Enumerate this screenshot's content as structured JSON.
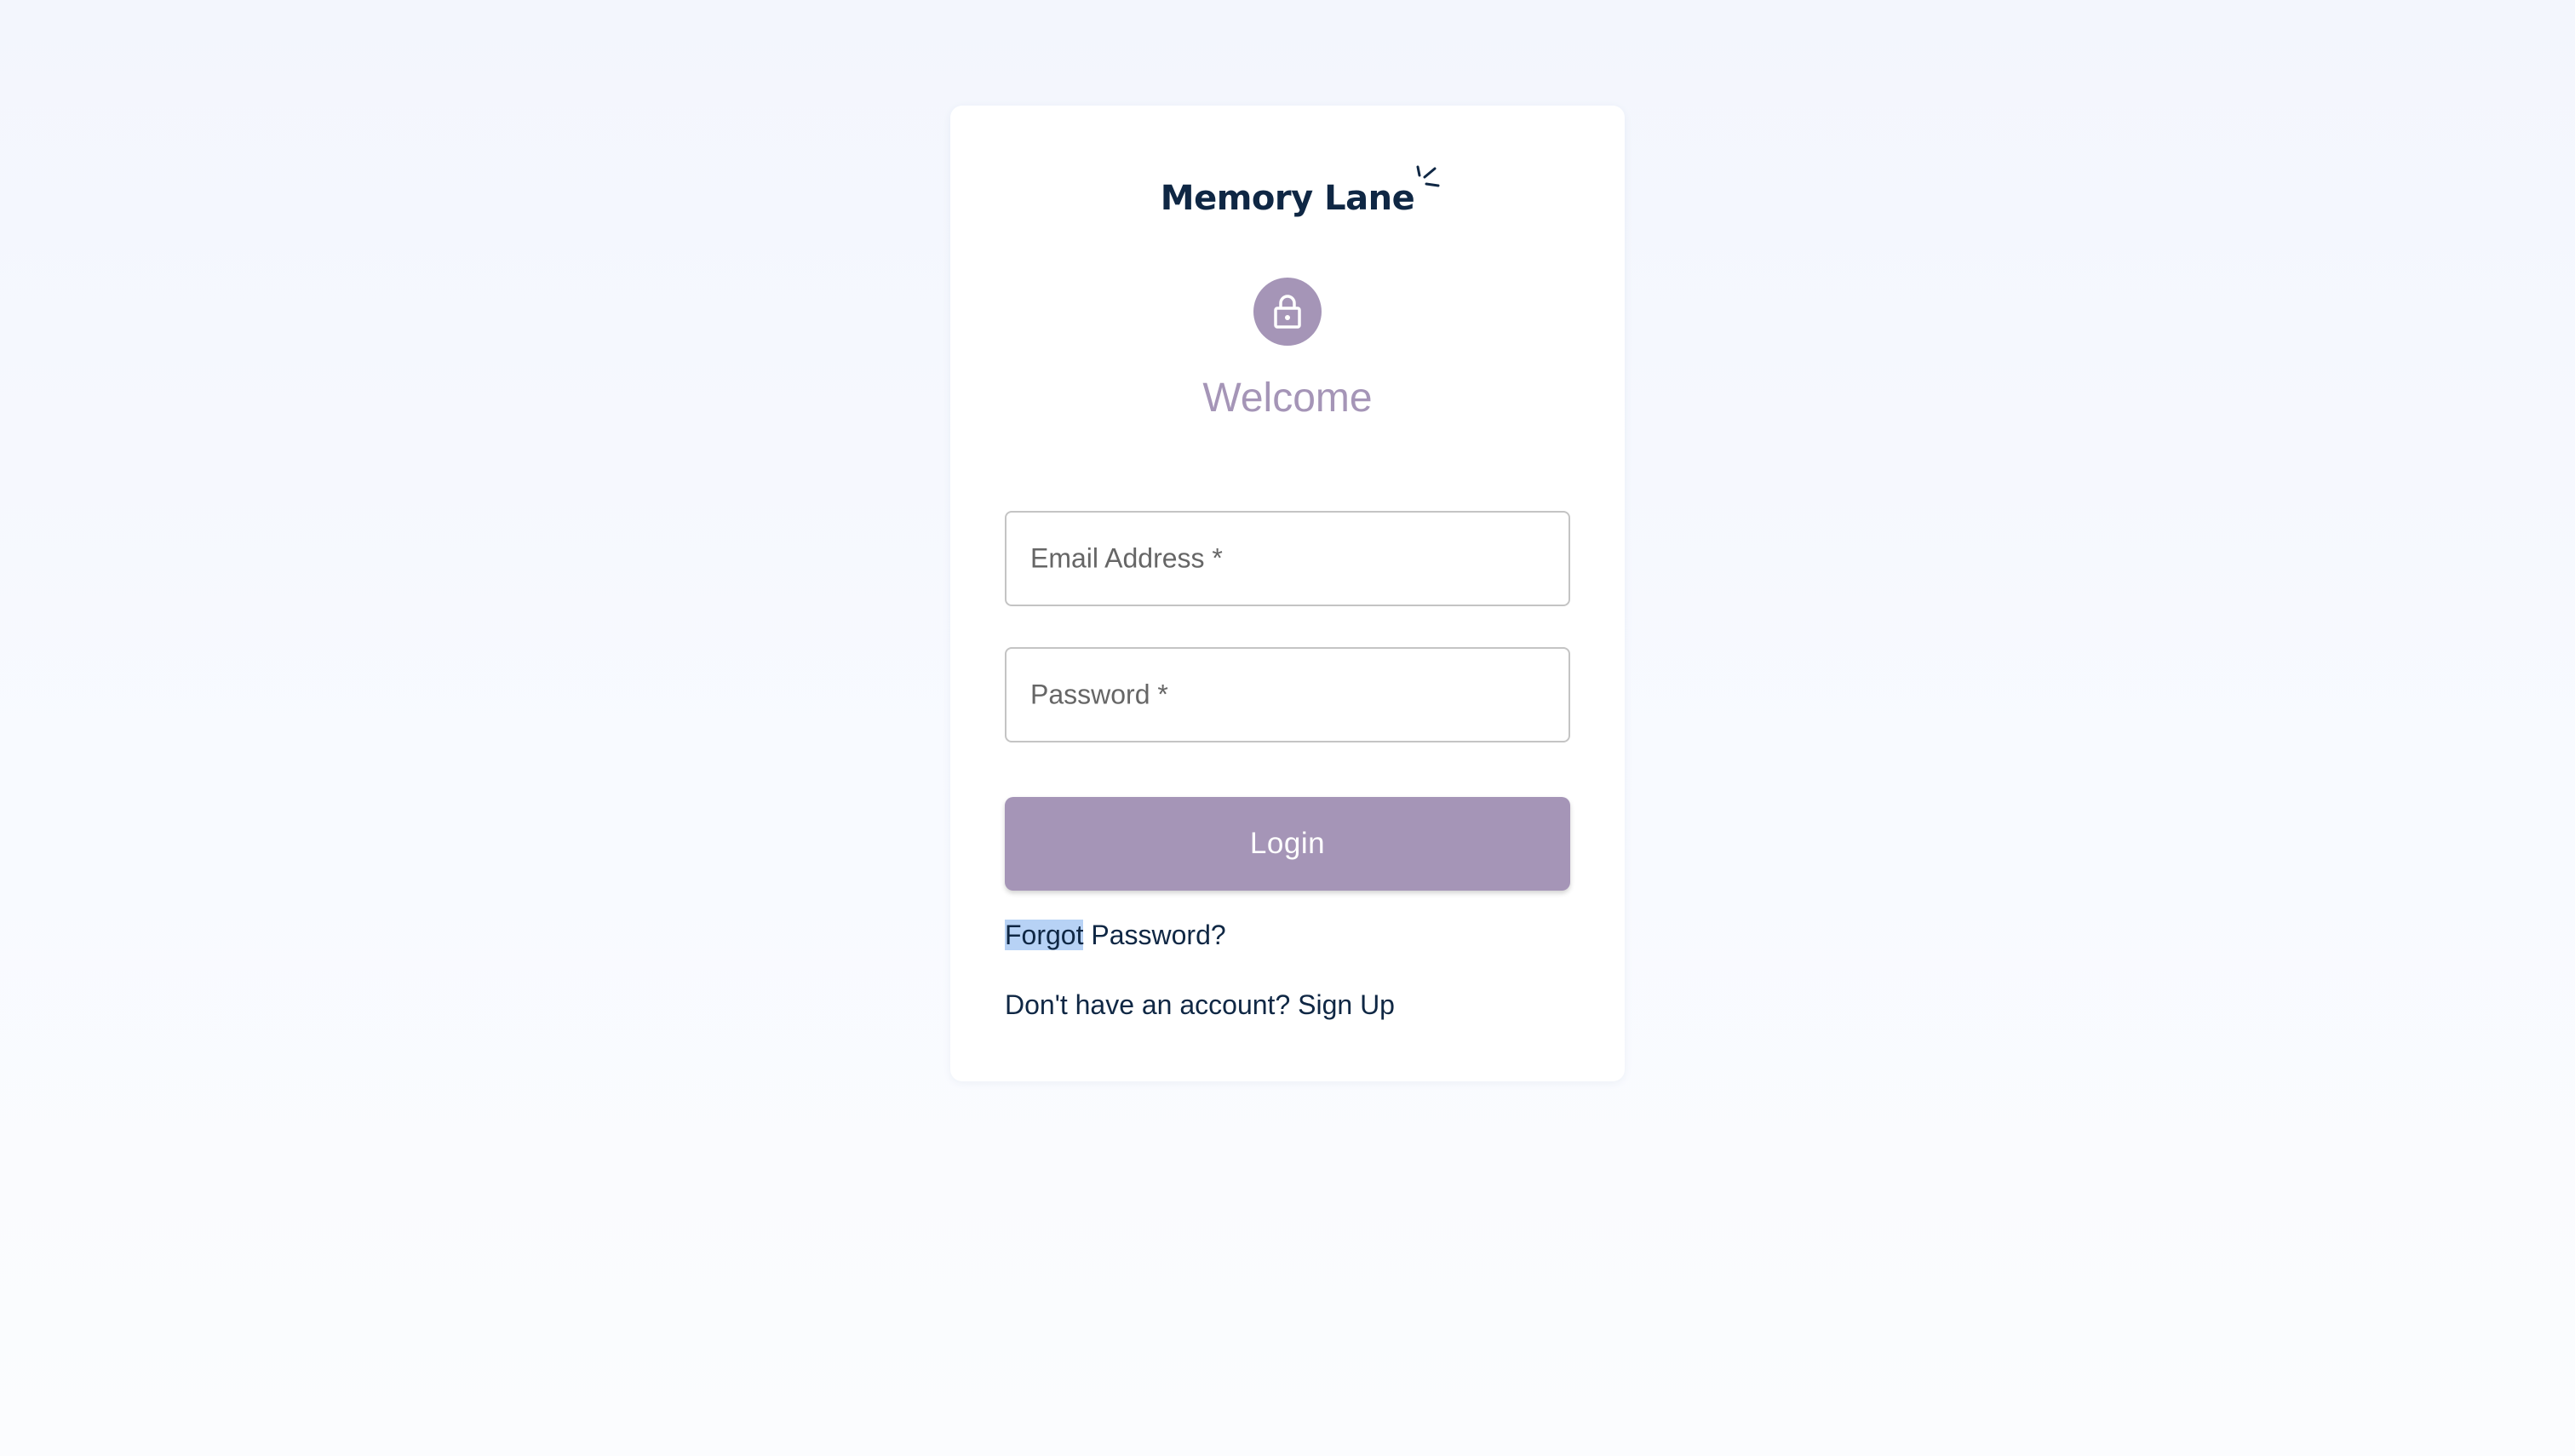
{
  "brand": {
    "name": "Memory Lane"
  },
  "login": {
    "lock_icon": "lock-icon",
    "heading": "Welcome",
    "email_label": "Email Address *",
    "password_label": "Password *",
    "submit_label": "Login",
    "forgot_highlighted": "Forgot",
    "forgot_rest": " Password?",
    "signup_text": "Don't have an account? Sign Up"
  },
  "colors": {
    "accent": "#a595b7",
    "brand_text": "#0f2744",
    "selection": "#b7d2f5"
  }
}
